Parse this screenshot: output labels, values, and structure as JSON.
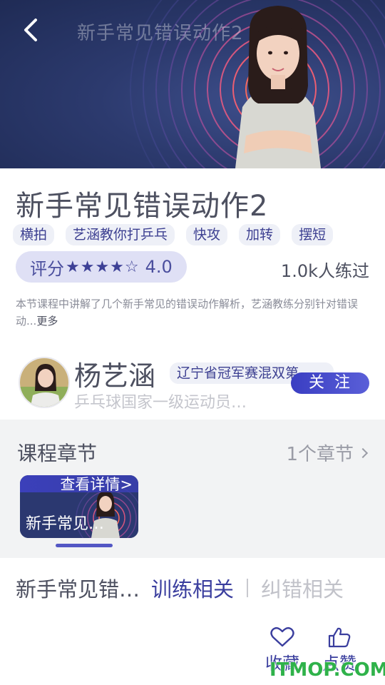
{
  "hero": {
    "title": "新手常见错误动作2"
  },
  "course": {
    "title": "新手常见错误动作2",
    "tags": [
      "横拍",
      "艺涵教你打乒乓",
      "快攻",
      "加转",
      "摆短"
    ],
    "rating_label": "评分",
    "rating_stars": "★★★★☆",
    "rating_value": "4.0",
    "rating_numeric": 4.0,
    "practiced": "1.0k人练过",
    "description": "本节课程中讲解了几个新手常见的错误动作解析，艺涵教练分别针对错误动...",
    "more": "更多"
  },
  "coach": {
    "name": "杨艺涵",
    "honor": "辽宁省冠军赛混双第",
    "subtitle": "乒乓球国家一级运动员…",
    "follow_label": "关注"
  },
  "chapters": {
    "title": "课程章节",
    "count": "1个章节",
    "items": [
      {
        "detail_label": "查看详情>",
        "name": "新手常见…"
      }
    ]
  },
  "tabs": {
    "current": "新手常见错…",
    "training": "训练相关",
    "correction": "纠错相关"
  },
  "actions": {
    "favorite": "收藏",
    "like": "点赞"
  },
  "watermark": "ITMOP.COM",
  "colors": {
    "accent": "#3a3e9e",
    "hero_bg": "#2c3a6e",
    "ring": "#ff5a6e",
    "watermark": "#2fb24a"
  }
}
